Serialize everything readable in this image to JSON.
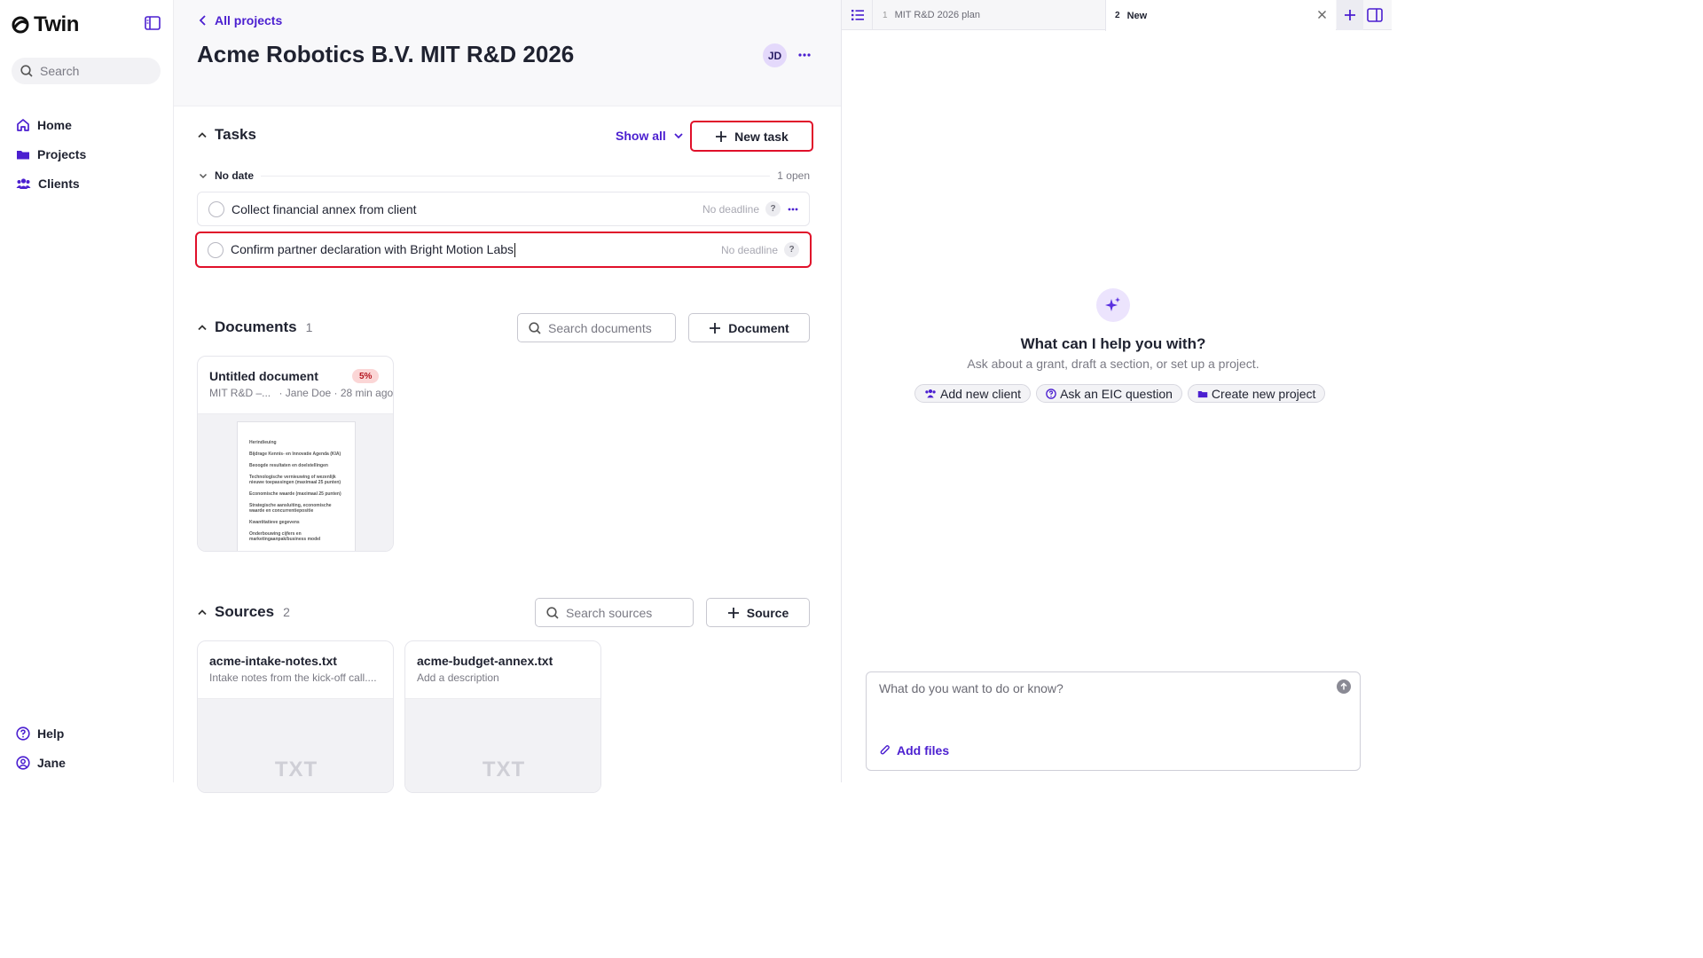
{
  "app": {
    "logo_text": "Twin",
    "search_placeholder": "Search"
  },
  "sidebar": {
    "items": [
      {
        "label": "Home",
        "icon": "home-icon"
      },
      {
        "label": "Projects",
        "icon": "folder-icon"
      },
      {
        "label": "Clients",
        "icon": "users-icon"
      }
    ],
    "bottom": [
      {
        "label": "Help",
        "icon": "help-icon"
      },
      {
        "label": "Jane",
        "icon": "user-circle-icon"
      }
    ]
  },
  "header": {
    "back_label": "All projects",
    "title": "Acme Robotics B.V. MIT R&D 2026",
    "avatar_initials": "JD"
  },
  "tasks": {
    "title": "Tasks",
    "show_all_label": "Show all",
    "new_task_label": "New task",
    "group_label": "No date",
    "group_count": "1 open",
    "items": [
      {
        "text": "Collect financial annex from client",
        "deadline": "No deadline"
      },
      {
        "text": "Confirm partner declaration with Bright Motion Labs",
        "deadline": "No deadline"
      }
    ],
    "help_mark": "?"
  },
  "documents": {
    "title": "Documents",
    "count": "1",
    "search_placeholder": "Search documents",
    "add_label": "Document",
    "items": [
      {
        "title": "Untitled document",
        "badge": "5%",
        "meta_project": "MIT R&D –...",
        "meta_author": "· Jane Doe · 28 min ago",
        "preview_lines": [
          "Herindieuing",
          "Bijdrage Kennis- en Innovatie Agenda (KIA)",
          "Beoogde resultaten en doelstellingen",
          "Technologische vernieuwing of wezenlijk nieuwe toepassingen (maximaal 25 punten)",
          "Economische waarde (maximaal 25 punten)",
          "Strategische aansluiting, economische waarde en concurrentiepositie",
          "Kwantitatieve gegevens",
          "Onderbouwing cijfers en marketingaanpak/business model"
        ]
      }
    ]
  },
  "sources": {
    "title": "Sources",
    "count": "2",
    "search_placeholder": "Search sources",
    "add_label": "Source",
    "items": [
      {
        "title": "acme-intake-notes.txt",
        "description": "Intake notes from the kick-off call....",
        "type": "TXT"
      },
      {
        "title": "acme-budget-annex.txt",
        "description": "Add a description",
        "type": "TXT"
      }
    ]
  },
  "right_panel": {
    "tabs": [
      {
        "num": "1",
        "label": "MIT R&D 2026 plan"
      },
      {
        "num": "2",
        "label": "New"
      }
    ],
    "assistant_title": "What can I help you with?",
    "assistant_sub": "Ask about a grant, draft a section, or set up a project.",
    "chips": [
      {
        "label": "Add new client",
        "icon": "users-icon"
      },
      {
        "label": "Ask an EIC question",
        "icon": "help-icon"
      },
      {
        "label": "Create new project",
        "icon": "folder-icon"
      }
    ],
    "composer_placeholder": "What do you want to do or know?",
    "add_files_label": "Add files"
  },
  "colors": {
    "accent": "#4b1fd0",
    "highlight_border": "#e0102a",
    "badge_bg": "#fbd6d6"
  }
}
